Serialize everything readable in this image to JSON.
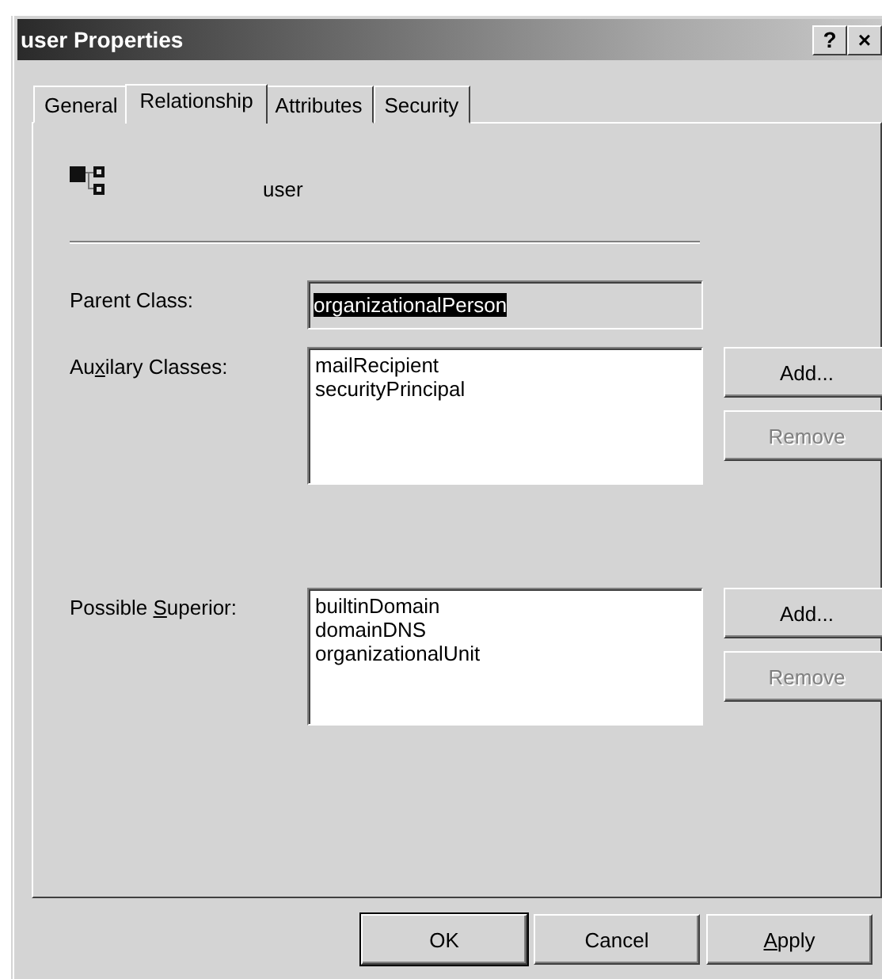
{
  "window": {
    "title": "user Properties",
    "title_buttons": [
      {
        "glyph": "?"
      },
      {
        "glyph": "×"
      }
    ]
  },
  "tabs": [
    {
      "label": "General",
      "selected": false
    },
    {
      "label": "Relationship",
      "selected": true
    },
    {
      "label": "Attributes",
      "selected": false
    },
    {
      "label": "Security",
      "selected": false
    }
  ],
  "header": {
    "class_name": "user"
  },
  "parent_class": {
    "label": [
      {
        "text": "Parent Class:",
        "underline": false
      }
    ],
    "value": "organizationalPerson",
    "disabled": true,
    "text_selected": true
  },
  "lists": [
    {
      "label": [
        {
          "text": "Au",
          "underline": false
        },
        {
          "text": "x",
          "underline": true
        },
        {
          "text": "ilary Classes:",
          "underline": false
        }
      ],
      "items": [
        "mailRecipient",
        "securityPrincipal"
      ],
      "buttons": [
        {
          "label": [
            {
              "text": "Add...",
              "underline": false
            }
          ],
          "disabled": false
        },
        {
          "label": [
            {
              "text": "Remove",
              "underline": false
            }
          ],
          "disabled": true
        }
      ]
    },
    {
      "label": [
        {
          "text": "Possible ",
          "underline": false
        },
        {
          "text": "S",
          "underline": true
        },
        {
          "text": "uperior:",
          "underline": false
        }
      ],
      "items": [
        "builtinDomain",
        "domainDNS",
        "organizationalUnit"
      ],
      "buttons": [
        {
          "label": [
            {
              "text": "Add...",
              "underline": false
            }
          ],
          "disabled": false
        },
        {
          "label": [
            {
              "text": "Remove",
              "underline": false
            }
          ],
          "disabled": true
        }
      ]
    }
  ],
  "footer_buttons": [
    {
      "label": [
        {
          "text": "OK",
          "underline": false
        }
      ],
      "default": true,
      "disabled": false
    },
    {
      "label": [
        {
          "text": "Cancel",
          "underline": false
        }
      ],
      "default": false,
      "disabled": false
    },
    {
      "label": [
        {
          "text": "A",
          "underline": true
        },
        {
          "text": "pply",
          "underline": false
        }
      ],
      "default": false,
      "disabled": false
    }
  ]
}
